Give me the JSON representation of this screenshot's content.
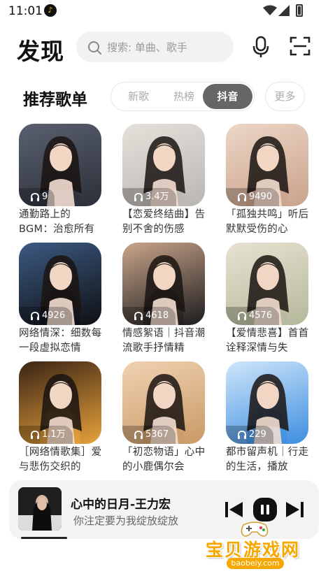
{
  "status_bar": {
    "time": "11:01"
  },
  "header": {
    "logo": "发现",
    "search_placeholder": "搜索: 单曲、歌手"
  },
  "section": {
    "title": "推荐歌单",
    "tabs": [
      "新歌",
      "热榜",
      "抖音"
    ],
    "active_tab": "抖音",
    "more_label": "更多"
  },
  "playlists": [
    {
      "plays": "9",
      "title": "通勤路上的BGM：治愈所有",
      "palette": [
        "#2b2f38",
        "#5a6070"
      ]
    },
    {
      "plays": "3.4万",
      "title": "【恋爱终结曲】告别不舍的伤感",
      "palette": [
        "#b9b6b2",
        "#e6e0da"
      ]
    },
    {
      "plays": "9490",
      "title": "「孤独共鸣」听后默默受伤的心",
      "palette": [
        "#caa28c",
        "#ecd6c6"
      ]
    },
    {
      "plays": "4926",
      "title": "网络情深：细数每一段虚拟恋情",
      "palette": [
        "#0f0f12",
        "#3c5a82"
      ]
    },
    {
      "plays": "4618",
      "title": "情感絮语｜抖音潮流歌手抒情精",
      "palette": [
        "#1d1c1e",
        "#c9a58a"
      ]
    },
    {
      "plays": "4576",
      "title": "【爱情悲喜】首首诠释深情与失",
      "palette": [
        "#b5b89a",
        "#e7e2d2"
      ]
    },
    {
      "plays": "1.1万",
      "title": "［网络情歌集］爱与悲伤交织的",
      "palette": [
        "#e7a23c",
        "#3a2414"
      ]
    },
    {
      "plays": "5367",
      "title": "「初恋物语」心中的小鹿偶尔会",
      "palette": [
        "#c99a66",
        "#f0d2b2"
      ]
    },
    {
      "plays": "229",
      "title": "都市留声机｜行走的生活，播放",
      "palette": [
        "#3d8ee0",
        "#cfe6fa"
      ]
    }
  ],
  "player": {
    "song": "心中的日月-王力宏",
    "lyric": "你注定要为我绽放绽放",
    "progress": 0.15
  },
  "watermark": {
    "text": "宝贝游戏网",
    "url": "baobeiy.com"
  },
  "colors": {
    "accent": "#666666",
    "watermark": "#f7a800"
  }
}
